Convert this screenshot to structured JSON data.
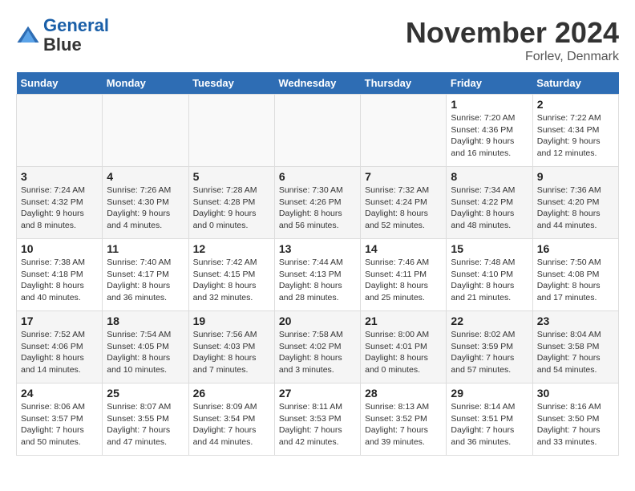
{
  "header": {
    "logo_line1": "General",
    "logo_line2": "Blue",
    "month": "November 2024",
    "location": "Forlev, Denmark"
  },
  "weekdays": [
    "Sunday",
    "Monday",
    "Tuesday",
    "Wednesday",
    "Thursday",
    "Friday",
    "Saturday"
  ],
  "weeks": [
    [
      {
        "day": "",
        "info": "",
        "empty": true
      },
      {
        "day": "",
        "info": "",
        "empty": true
      },
      {
        "day": "",
        "info": "",
        "empty": true
      },
      {
        "day": "",
        "info": "",
        "empty": true
      },
      {
        "day": "",
        "info": "",
        "empty": true
      },
      {
        "day": "1",
        "info": "Sunrise: 7:20 AM\nSunset: 4:36 PM\nDaylight: 9 hours and 16 minutes.",
        "empty": false
      },
      {
        "day": "2",
        "info": "Sunrise: 7:22 AM\nSunset: 4:34 PM\nDaylight: 9 hours and 12 minutes.",
        "empty": false
      }
    ],
    [
      {
        "day": "3",
        "info": "Sunrise: 7:24 AM\nSunset: 4:32 PM\nDaylight: 9 hours and 8 minutes.",
        "empty": false
      },
      {
        "day": "4",
        "info": "Sunrise: 7:26 AM\nSunset: 4:30 PM\nDaylight: 9 hours and 4 minutes.",
        "empty": false
      },
      {
        "day": "5",
        "info": "Sunrise: 7:28 AM\nSunset: 4:28 PM\nDaylight: 9 hours and 0 minutes.",
        "empty": false
      },
      {
        "day": "6",
        "info": "Sunrise: 7:30 AM\nSunset: 4:26 PM\nDaylight: 8 hours and 56 minutes.",
        "empty": false
      },
      {
        "day": "7",
        "info": "Sunrise: 7:32 AM\nSunset: 4:24 PM\nDaylight: 8 hours and 52 minutes.",
        "empty": false
      },
      {
        "day": "8",
        "info": "Sunrise: 7:34 AM\nSunset: 4:22 PM\nDaylight: 8 hours and 48 minutes.",
        "empty": false
      },
      {
        "day": "9",
        "info": "Sunrise: 7:36 AM\nSunset: 4:20 PM\nDaylight: 8 hours and 44 minutes.",
        "empty": false
      }
    ],
    [
      {
        "day": "10",
        "info": "Sunrise: 7:38 AM\nSunset: 4:18 PM\nDaylight: 8 hours and 40 minutes.",
        "empty": false
      },
      {
        "day": "11",
        "info": "Sunrise: 7:40 AM\nSunset: 4:17 PM\nDaylight: 8 hours and 36 minutes.",
        "empty": false
      },
      {
        "day": "12",
        "info": "Sunrise: 7:42 AM\nSunset: 4:15 PM\nDaylight: 8 hours and 32 minutes.",
        "empty": false
      },
      {
        "day": "13",
        "info": "Sunrise: 7:44 AM\nSunset: 4:13 PM\nDaylight: 8 hours and 28 minutes.",
        "empty": false
      },
      {
        "day": "14",
        "info": "Sunrise: 7:46 AM\nSunset: 4:11 PM\nDaylight: 8 hours and 25 minutes.",
        "empty": false
      },
      {
        "day": "15",
        "info": "Sunrise: 7:48 AM\nSunset: 4:10 PM\nDaylight: 8 hours and 21 minutes.",
        "empty": false
      },
      {
        "day": "16",
        "info": "Sunrise: 7:50 AM\nSunset: 4:08 PM\nDaylight: 8 hours and 17 minutes.",
        "empty": false
      }
    ],
    [
      {
        "day": "17",
        "info": "Sunrise: 7:52 AM\nSunset: 4:06 PM\nDaylight: 8 hours and 14 minutes.",
        "empty": false
      },
      {
        "day": "18",
        "info": "Sunrise: 7:54 AM\nSunset: 4:05 PM\nDaylight: 8 hours and 10 minutes.",
        "empty": false
      },
      {
        "day": "19",
        "info": "Sunrise: 7:56 AM\nSunset: 4:03 PM\nDaylight: 8 hours and 7 minutes.",
        "empty": false
      },
      {
        "day": "20",
        "info": "Sunrise: 7:58 AM\nSunset: 4:02 PM\nDaylight: 8 hours and 3 minutes.",
        "empty": false
      },
      {
        "day": "21",
        "info": "Sunrise: 8:00 AM\nSunset: 4:01 PM\nDaylight: 8 hours and 0 minutes.",
        "empty": false
      },
      {
        "day": "22",
        "info": "Sunrise: 8:02 AM\nSunset: 3:59 PM\nDaylight: 7 hours and 57 minutes.",
        "empty": false
      },
      {
        "day": "23",
        "info": "Sunrise: 8:04 AM\nSunset: 3:58 PM\nDaylight: 7 hours and 54 minutes.",
        "empty": false
      }
    ],
    [
      {
        "day": "24",
        "info": "Sunrise: 8:06 AM\nSunset: 3:57 PM\nDaylight: 7 hours and 50 minutes.",
        "empty": false
      },
      {
        "day": "25",
        "info": "Sunrise: 8:07 AM\nSunset: 3:55 PM\nDaylight: 7 hours and 47 minutes.",
        "empty": false
      },
      {
        "day": "26",
        "info": "Sunrise: 8:09 AM\nSunset: 3:54 PM\nDaylight: 7 hours and 44 minutes.",
        "empty": false
      },
      {
        "day": "27",
        "info": "Sunrise: 8:11 AM\nSunset: 3:53 PM\nDaylight: 7 hours and 42 minutes.",
        "empty": false
      },
      {
        "day": "28",
        "info": "Sunrise: 8:13 AM\nSunset: 3:52 PM\nDaylight: 7 hours and 39 minutes.",
        "empty": false
      },
      {
        "day": "29",
        "info": "Sunrise: 8:14 AM\nSunset: 3:51 PM\nDaylight: 7 hours and 36 minutes.",
        "empty": false
      },
      {
        "day": "30",
        "info": "Sunrise: 8:16 AM\nSunset: 3:50 PM\nDaylight: 7 hours and 33 minutes.",
        "empty": false
      }
    ]
  ]
}
